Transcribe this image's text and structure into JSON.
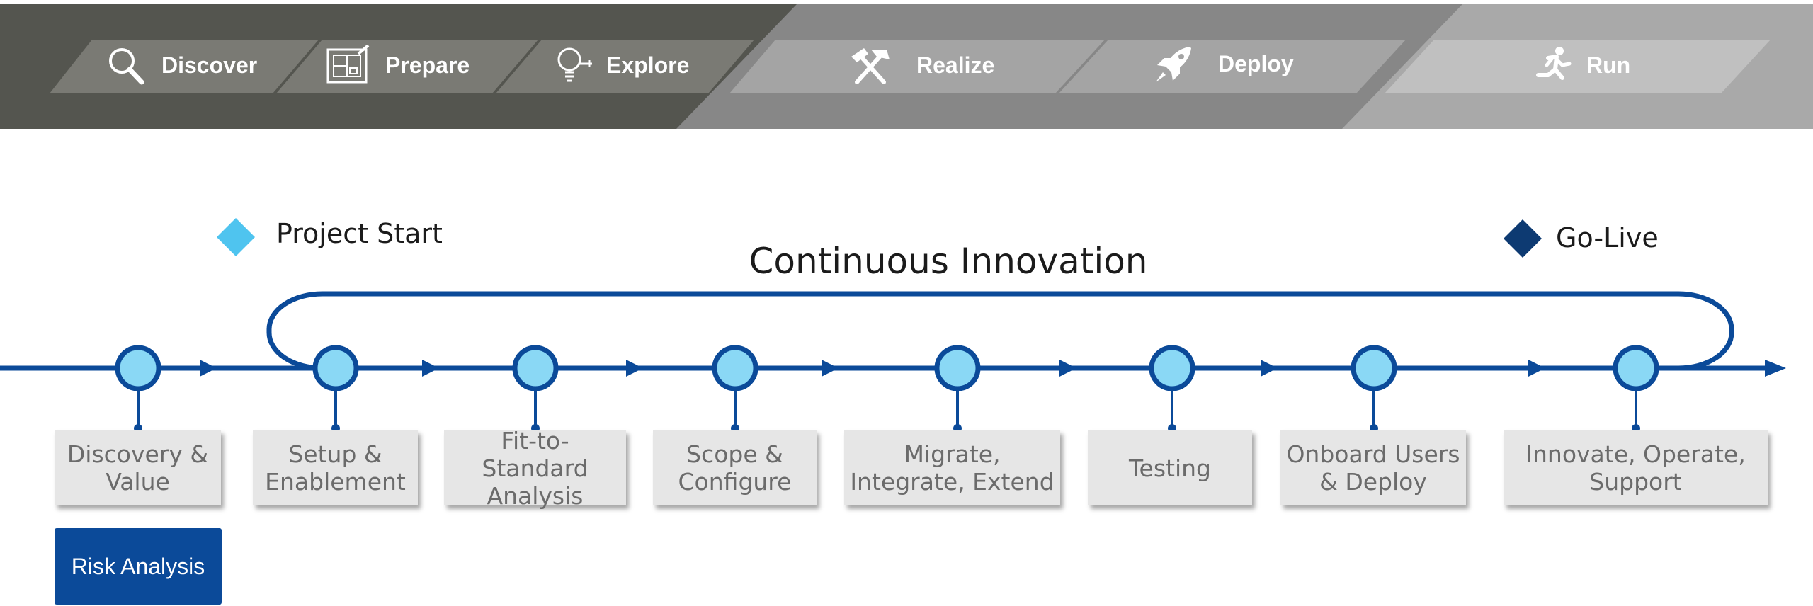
{
  "header": {
    "phases": [
      {
        "label": "Discover",
        "icon": "magnifier-icon"
      },
      {
        "label": "Prepare",
        "icon": "blueprint-icon"
      },
      {
        "label": "Explore",
        "icon": "lightbulb-icon"
      },
      {
        "label": "Realize",
        "icon": "hammer-pick-icon"
      },
      {
        "label": "Deploy",
        "icon": "rocket-icon"
      },
      {
        "label": "Run",
        "icon": "runner-icon"
      }
    ]
  },
  "milestones": {
    "start": {
      "label": "Project Start",
      "color": "#4fc4ef"
    },
    "golive": {
      "label": "Go-Live",
      "color": "#0d3a72"
    }
  },
  "loop": {
    "title": "Continuous Innovation"
  },
  "steps": [
    {
      "label": "Discovery & Value"
    },
    {
      "label": "Setup & Enablement"
    },
    {
      "label": "Fit-to-Standard Analysis"
    },
    {
      "label": "Scope & Configure"
    },
    {
      "label": "Migrate, Integrate, Extend"
    },
    {
      "label": "Testing"
    },
    {
      "label": "Onboard Users & Deploy"
    },
    {
      "label": "Innovate, Operate, Support"
    }
  ],
  "risk": {
    "label": "Risk Analysis"
  },
  "colors": {
    "line": "#0b4a99",
    "node_fill": "#8ad8f5",
    "header_dark": "#54554f",
    "header_mid": "#878787",
    "header_light": "#a9a9a9"
  }
}
